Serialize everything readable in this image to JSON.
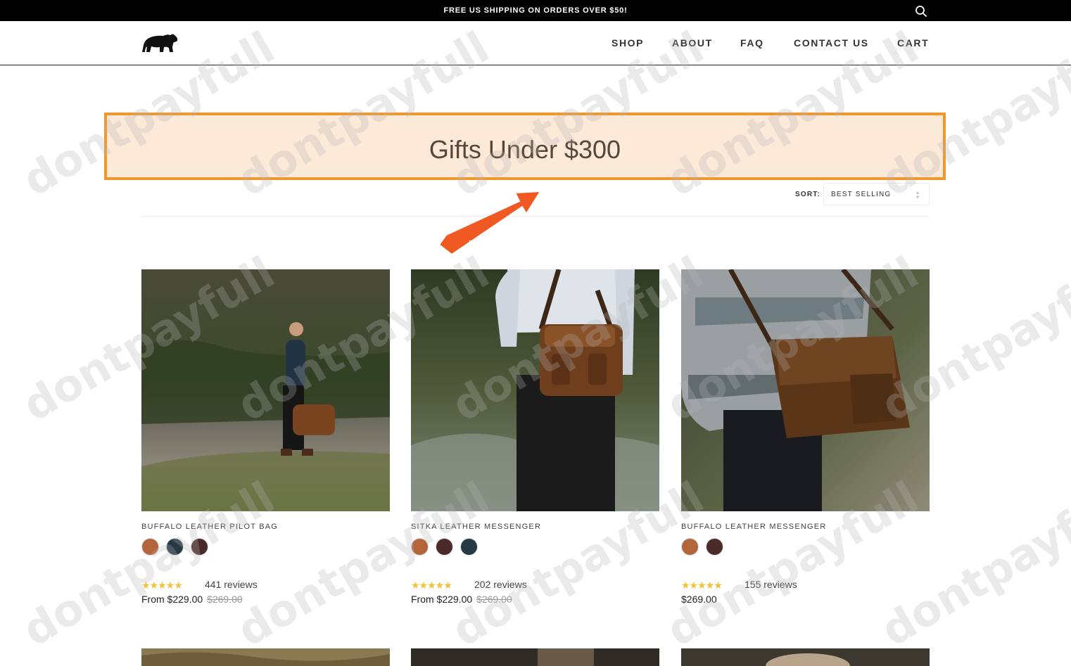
{
  "topbar": {
    "promo": "FREE US SHIPPING ON ORDERS OVER $50!",
    "search_icon": "search-icon"
  },
  "nav": {
    "shop": "SHOP",
    "about": "ABOUT",
    "faq": "FAQ",
    "contact": "CONTACT US",
    "cart": "CART"
  },
  "hero": {
    "title": "Gifts Under $300"
  },
  "sort": {
    "label": "SORT:",
    "value": "BEST SELLING"
  },
  "watermark": {
    "text": "dontpayfull",
    "badge_text": "dontpayfull"
  },
  "products": [
    {
      "title": "BUFFALO LEATHER PILOT BAG",
      "swatches": [
        "#b4653c",
        "#243a44",
        "#4a2b2a"
      ],
      "reviews": "441 reviews",
      "price": "From $229.00",
      "compare": "$269.00"
    },
    {
      "title": "SITKA LEATHER MESSENGER",
      "swatches": [
        "#b4653c",
        "#4a2b2a",
        "#243a44"
      ],
      "reviews": "202 reviews",
      "price": "From $229.00",
      "compare": "$269.00"
    },
    {
      "title": "BUFFALO LEATHER MESSENGER",
      "swatches": [
        "#b4653c",
        "#4a2b2a"
      ],
      "reviews": "155 reviews",
      "price": "$269.00",
      "compare": ""
    }
  ],
  "stars": "★★★★★",
  "colors": {
    "hero_border": "#f0982f",
    "hero_bg": "#fde9d8",
    "badge": "#f05a22",
    "star": "#f4c038"
  }
}
